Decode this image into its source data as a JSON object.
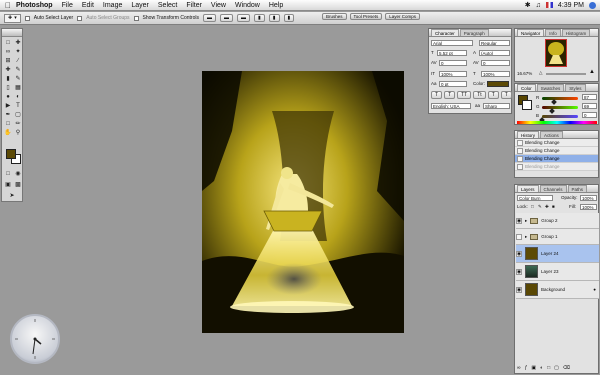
{
  "menubar": {
    "app": "Photoshop",
    "items": [
      "File",
      "Edit",
      "Image",
      "Layer",
      "Select",
      "Filter",
      "View",
      "Window",
      "Help"
    ],
    "clock_text": "4:39 PM"
  },
  "options_bar": {
    "auto_select_layer": "Auto Select Layer",
    "auto_select_groups": "Auto Select Groups",
    "show_transform_controls": "Show Transform Controls"
  },
  "dock": {
    "items": [
      "Brushes",
      "Tool Presets",
      "Layer Comps"
    ]
  },
  "character": {
    "tabs": [
      "Character",
      "Paragraph"
    ],
    "font_family": "Arial",
    "font_style": "Regular",
    "font_size": "5.52 pt",
    "leading": "(Auto)",
    "tracking": "0",
    "kerning": "0",
    "vertical_scale": "100%",
    "horizontal_scale": "100%",
    "baseline_shift": "0 pt",
    "color_label": "Color:",
    "language": "English: USA",
    "antialias": "Sharp"
  },
  "navigator": {
    "tabs": [
      "Navigator",
      "Info",
      "Histogram"
    ],
    "zoom": "16.67%"
  },
  "color": {
    "tabs": [
      "Color",
      "Swatches",
      "Styles"
    ],
    "rows": [
      {
        "label": "R",
        "value": "87",
        "level": 0.34
      },
      {
        "label": "G",
        "value": "69",
        "level": 0.27
      },
      {
        "label": "B",
        "value": "0",
        "level": 0.0
      }
    ],
    "swatch_color": "#574500"
  },
  "history": {
    "tabs": [
      "History",
      "Actions"
    ],
    "items": [
      {
        "label": "Blending Change",
        "state": "normal"
      },
      {
        "label": "Blending Change",
        "state": "normal"
      },
      {
        "label": "Blending Change",
        "state": "selected"
      },
      {
        "label": "Blending Change",
        "state": "dimmed"
      }
    ]
  },
  "layers": {
    "tabs": [
      "Layers",
      "Channels",
      "Paths"
    ],
    "blend_mode": "Color Burn",
    "opacity_label": "Opacity:",
    "opacity": "100%",
    "lock_label": "Lock:",
    "fill_label": "Fill:",
    "fill": "100%",
    "rows": [
      {
        "name": "Group 2",
        "kind": "group",
        "visible": true
      },
      {
        "name": "Group 1",
        "kind": "group",
        "visible": false
      },
      {
        "name": "Layer 24",
        "kind": "layer",
        "visible": true,
        "selected": true
      },
      {
        "name": "Layer 23",
        "kind": "layer",
        "visible": true
      },
      {
        "name": "Background",
        "kind": "background",
        "visible": true
      }
    ]
  },
  "colors": {
    "foreground": "#5c4a06",
    "accent": "#8fb0e8"
  }
}
